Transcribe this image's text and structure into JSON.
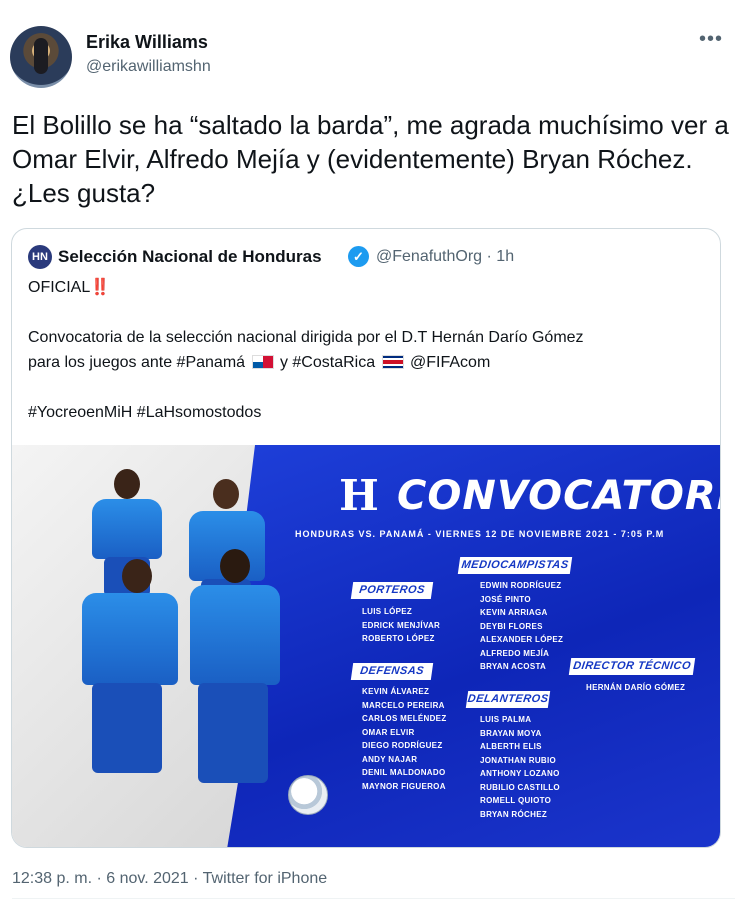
{
  "author": {
    "display_name": "Erika Williams",
    "handle": "@erikawilliamshn",
    "avatar_icon": "profile-photo"
  },
  "more_icon": "•••",
  "tweet_text": "El Bolillo se ha “saltado la barda”, me agrada muchísimo ver a Omar Elvir, Alfredo Mejía y (evidentemente) Bryan Róchez. ¿Les gusta?",
  "quoted": {
    "avatar_text": "HN",
    "display_name": "Selección Nacional de Honduras",
    "verified_icon": "✓",
    "handle_time": "@FenafuthOrg · 1h",
    "line1": "OFICIAL‼️",
    "line2a": "Convocatoria de la selección nacional dirigida por el D.T Hernán Darío Gómez",
    "line2b_prefix": "para los juegos ante #Panamá",
    "line2b_mid": "y #CostaRica",
    "line2b_suffix": "@FIFAcom",
    "line3": "#YocreoenMiH #LaHsomostodos",
    "flag_pa": "panama-flag",
    "flag_cr": "costa-rica-flag"
  },
  "poster": {
    "crest": "H",
    "title": "CONVOCATORIA",
    "match_line": "HONDURAS VS. PANAMÁ - VIERNES 12 DE NOVIEMBRE 2021 - 7:05 P.M",
    "porteros_label": "PORTEROS",
    "porteros": [
      "LUIS LÓPEZ",
      "EDRICK MENJÍVAR",
      "ROBERTO LÓPEZ"
    ],
    "defensas_label": "DEFENSAS",
    "defensas": [
      "KEVIN ÁLVAREZ",
      "MARCELO PEREIRA",
      "CARLOS MELÉNDEZ",
      "OMAR ELVIR",
      "DIEGO RODRÍGUEZ",
      "ANDY NAJAR",
      "DENIL MALDONADO",
      "MAYNOR FIGUEROA"
    ],
    "medios_label": "MEDIOCAMPISTAS",
    "medios": [
      "EDWIN RODRÍGUEZ",
      "JOSÉ PINTO",
      "KEVIN ARRIAGA",
      "DEYBI FLORES",
      "ALEXANDER LÓPEZ",
      "ALFREDO MEJÍA",
      "BRYAN ACOSTA"
    ],
    "delanteros_label": "DELANTEROS",
    "delanteros": [
      "LUIS PALMA",
      "BRAYAN MOYA",
      "ALBERTH ELIS",
      "JONATHAN RUBIO",
      "ANTHONY LOZANO",
      "RUBILIO CASTILLO",
      "ROMELL QUIOTO",
      "BRYAN RÓCHEZ"
    ],
    "director_label": "DIRECTOR TÉCNICO",
    "director": "HERNÁN DARÍO GÓMEZ"
  },
  "footer": {
    "timestamp": "12:38 p. m. · 6 nov. 2021 · Twitter for iPhone"
  },
  "colors": {
    "accent_blue": "#1d9bf0",
    "poster_blue": "#1538c4",
    "muted_text": "#536471"
  }
}
